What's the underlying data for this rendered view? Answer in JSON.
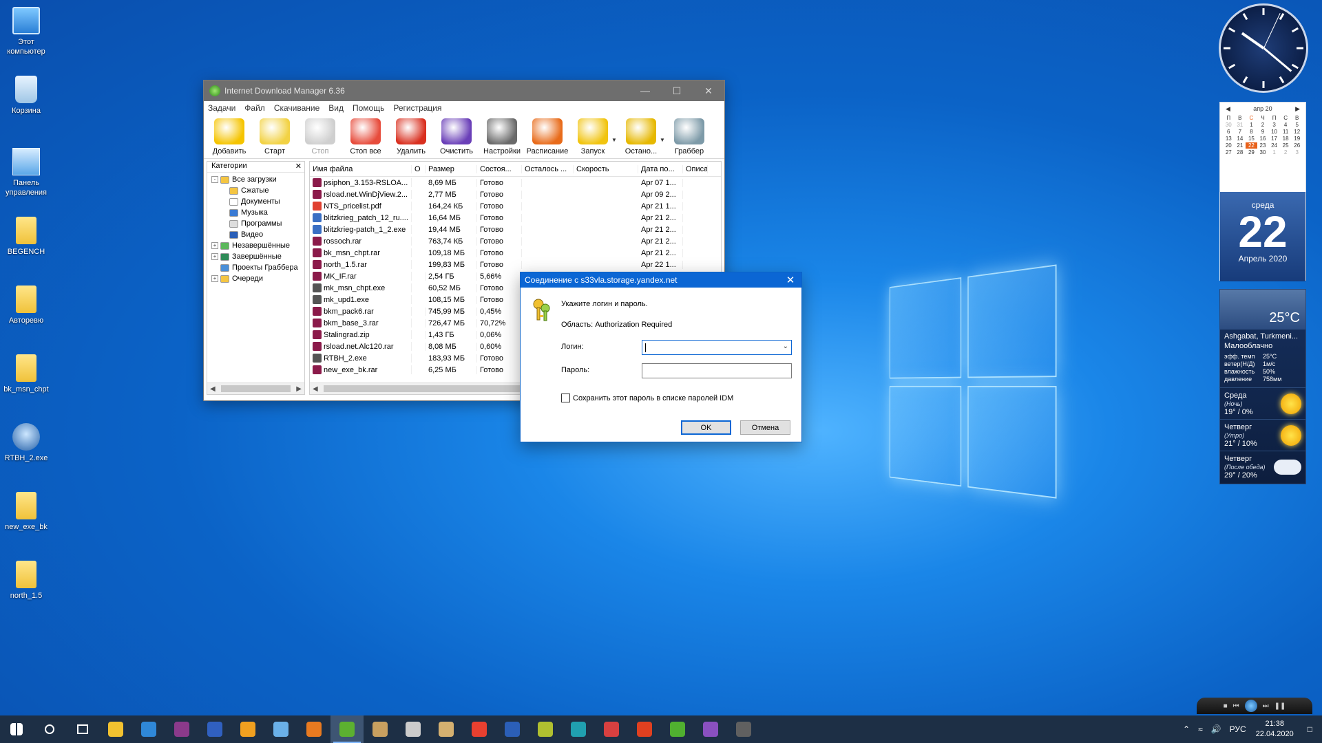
{
  "desktop_icons": [
    {
      "label": "Этот компьютер",
      "icon": "computer-icon"
    },
    {
      "label": "Корзина",
      "icon": "recycle-bin-icon"
    },
    {
      "label": "Панель управления",
      "icon": "control-panel-icon"
    },
    {
      "label": "BEGENCH",
      "icon": "folder-icon"
    },
    {
      "label": "Авторевю",
      "icon": "folder-icon"
    },
    {
      "label": "bk_msn_chpt",
      "icon": "folder-icon"
    },
    {
      "label": "RTBH_2.exe",
      "icon": "exe-icon"
    },
    {
      "label": "new_exe_bk",
      "icon": "folder-icon"
    },
    {
      "label": "north_1.5",
      "icon": "folder-icon"
    }
  ],
  "idm": {
    "title": "Internet Download Manager 6.36",
    "menu": [
      "Задачи",
      "Файл",
      "Скачивание",
      "Вид",
      "Помощь",
      "Регистрация"
    ],
    "toolbar": [
      {
        "label": "Добавить",
        "color": "#f5c400",
        "enabled": true
      },
      {
        "label": "Старт",
        "color": "#f2d244",
        "enabled": true
      },
      {
        "label": "Стоп",
        "color": "#cfcfcf",
        "enabled": false
      },
      {
        "label": "Стоп все",
        "color": "#e74c3c",
        "enabled": true
      },
      {
        "label": "Удалить",
        "color": "#d92f1f",
        "enabled": true
      },
      {
        "label": "Очистить",
        "color": "#6a3fb8",
        "enabled": true
      },
      {
        "label": "Настройки",
        "color": "#6a6a6a",
        "enabled": true
      },
      {
        "label": "Расписание",
        "color": "#e86b1a",
        "enabled": true
      },
      {
        "label": "Запуск",
        "color": "#f1c40f",
        "enabled": true
      },
      {
        "label": "Остано...",
        "color": "#e6b800",
        "enabled": true
      },
      {
        "label": "Граббер",
        "color": "#7d9aa8",
        "enabled": true
      }
    ],
    "categories": {
      "header": "Категории",
      "items": [
        {
          "label": "Все загрузки",
          "level": 0,
          "expander": "-",
          "color": "#f4c542"
        },
        {
          "label": "Сжатые",
          "level": 1,
          "expander": "",
          "color": "#f4c542"
        },
        {
          "label": "Документы",
          "level": 1,
          "expander": "",
          "color": "#ffffff"
        },
        {
          "label": "Музыка",
          "level": 1,
          "expander": "",
          "color": "#3a7bd5"
        },
        {
          "label": "Программы",
          "level": 1,
          "expander": "",
          "color": "#dddddd"
        },
        {
          "label": "Видео",
          "level": 1,
          "expander": "",
          "color": "#2a5fb8"
        },
        {
          "label": "Незавершённые",
          "level": 0,
          "expander": "+",
          "color": "#5cb85c"
        },
        {
          "label": "Завершённые",
          "level": 0,
          "expander": "+",
          "color": "#2e8b57"
        },
        {
          "label": "Проекты Граббера",
          "level": 0,
          "expander": "",
          "color": "#4a8fd8"
        },
        {
          "label": "Очереди",
          "level": 0,
          "expander": "+",
          "color": "#f4c542"
        }
      ]
    },
    "columns": [
      "Имя файла",
      "О",
      "Размер",
      "Состоя...",
      "Осталось ...",
      "Скорость",
      "Дата по...",
      "Описа"
    ],
    "files": [
      {
        "name": "psiphon_3.153-RSLOA...",
        "q": "",
        "size": "8,69 МБ",
        "status": "Готово",
        "left": "",
        "speed": "",
        "date": "Apr 07 1...",
        "icon": "#8b1a4a"
      },
      {
        "name": "rsload.net.WinDjView.2...",
        "q": "",
        "size": "2,77 МБ",
        "status": "Готово",
        "left": "",
        "speed": "",
        "date": "Apr 09 2...",
        "icon": "#8b1a4a"
      },
      {
        "name": "NTS_pricelist.pdf",
        "q": "",
        "size": "164,24 КБ",
        "status": "Готово",
        "left": "",
        "speed": "",
        "date": "Apr 21 1...",
        "icon": "#e04030"
      },
      {
        "name": "blitzkrieg_patch_12_ru....",
        "q": "",
        "size": "16,64 МБ",
        "status": "Готово",
        "left": "",
        "speed": "",
        "date": "Apr 21 2...",
        "icon": "#3a6fc4"
      },
      {
        "name": "blitzkrieg-patch_1_2.exe",
        "q": "",
        "size": "19,44 МБ",
        "status": "Готово",
        "left": "",
        "speed": "",
        "date": "Apr 21 2...",
        "icon": "#3a6fc4"
      },
      {
        "name": "rossoch.rar",
        "q": "",
        "size": "763,74 КБ",
        "status": "Готово",
        "left": "",
        "speed": "",
        "date": "Apr 21 2...",
        "icon": "#8b1a4a"
      },
      {
        "name": "bk_msn_chpt.rar",
        "q": "",
        "size": "109,18 МБ",
        "status": "Готово",
        "left": "",
        "speed": "",
        "date": "Apr 21 2...",
        "icon": "#8b1a4a"
      },
      {
        "name": "north_1.5.rar",
        "q": "",
        "size": "199,83 МБ",
        "status": "Готово",
        "left": "",
        "speed": "",
        "date": "Apr 22 1...",
        "icon": "#8b1a4a"
      },
      {
        "name": "MK_IF.rar",
        "q": "folder",
        "size": "2,54 ГБ",
        "status": "5,66%",
        "left": "",
        "speed": "",
        "date": "",
        "icon": "#8b1a4a"
      },
      {
        "name": "mk_msn_chpt.exe",
        "q": "",
        "size": "60,52 МБ",
        "status": "Готово",
        "left": "",
        "speed": "",
        "date": "",
        "icon": "#555555"
      },
      {
        "name": "mk_upd1.exe",
        "q": "",
        "size": "108,15 МБ",
        "status": "Готово",
        "left": "",
        "speed": "",
        "date": "",
        "icon": "#555555"
      },
      {
        "name": "bkm_pack6.rar",
        "q": "folder",
        "size": "745,99 МБ",
        "status": "0,45%",
        "left": "",
        "speed": "",
        "date": "",
        "icon": "#8b1a4a"
      },
      {
        "name": "bkm_base_3.rar",
        "q": "folder",
        "size": "726,47 МБ",
        "status": "70,72%",
        "left": "",
        "speed": "",
        "date": "",
        "icon": "#8b1a4a"
      },
      {
        "name": "Stalingrad.zip",
        "q": "folder",
        "size": "1,43 ГБ",
        "status": "0,06%",
        "left": "",
        "speed": "",
        "date": "",
        "icon": "#8b1a4a"
      },
      {
        "name": "rsload.net.Alc120.rar",
        "q": "folder",
        "size": "8,08 МБ",
        "status": "0,60%",
        "left": "",
        "speed": "",
        "date": "",
        "icon": "#8b1a4a"
      },
      {
        "name": "RTBH_2.exe",
        "q": "",
        "size": "183,93 МБ",
        "status": "Готово",
        "left": "",
        "speed": "",
        "date": "",
        "icon": "#555555"
      },
      {
        "name": "new_exe_bk.rar",
        "q": "",
        "size": "6,25 МБ",
        "status": "Готово",
        "left": "",
        "speed": "",
        "date": "",
        "icon": "#8b1a4a"
      }
    ]
  },
  "dialog": {
    "title": "Соединение с s33vla.storage.yandex.net",
    "prompt": "Укажите логин и пароль.",
    "realm": "Область: Authorization Required",
    "login_label": "Логин:",
    "login_value": "",
    "password_label": "Пароль:",
    "password_value": "",
    "save_checkbox_label": "Сохранить этот пароль в списке паролей IDM",
    "save_checked": false,
    "ok_label": "OK",
    "cancel_label": "Отмена"
  },
  "gadgets": {
    "calendar": {
      "month_label": "апр 20",
      "weekdays": [
        "П",
        "В",
        "С",
        "Ч",
        "П",
        "С",
        "В"
      ],
      "weeks": [
        [
          "30",
          "31",
          "1",
          "2",
          "3",
          "4",
          "5"
        ],
        [
          "6",
          "7",
          "8",
          "9",
          "10",
          "11",
          "12"
        ],
        [
          "13",
          "14",
          "15",
          "16",
          "17",
          "18",
          "19"
        ],
        [
          "20",
          "21",
          "22",
          "23",
          "24",
          "25",
          "26"
        ],
        [
          "27",
          "28",
          "29",
          "30",
          "1",
          "2",
          "3"
        ]
      ],
      "today": "22",
      "weekday_name": "среда",
      "day_number": "22",
      "month_year": "Апрель 2020"
    },
    "weather": {
      "temperature": "25°C",
      "location": "Ashgabat, Turkmeni...",
      "condition": "Малооблачно",
      "details": [
        {
          "label": "эфф. темп",
          "value": "25°C"
        },
        {
          "label": "ветер(Н/Д)",
          "value": "1м/с"
        },
        {
          "label": "влажность",
          "value": "50%"
        },
        {
          "label": "давление",
          "value": "758мм"
        }
      ],
      "forecast": [
        {
          "day": "Среда",
          "part": "(Ночь)",
          "temps": "19° /  0%",
          "icon": "sun-icon"
        },
        {
          "day": "Четверг",
          "part": "(Утро)",
          "temps": "21° /  10%",
          "icon": "sun-icon"
        },
        {
          "day": "Четверг",
          "part": "(После обеда)",
          "temps": "29° /  20%",
          "icon": "cloud-icon"
        }
      ]
    }
  },
  "taskbar": {
    "apps": [
      {
        "name": "start-button",
        "color": "#ffffff"
      },
      {
        "name": "search-icon",
        "color": "#ffffff"
      },
      {
        "name": "task-view-icon",
        "color": "#ffffff"
      },
      {
        "name": "file-explorer-icon",
        "color": "#f2c230"
      },
      {
        "name": "edge-icon",
        "color": "#2f88d8"
      },
      {
        "name": "winrar-icon",
        "color": "#8b3a8b"
      },
      {
        "name": "save-icon",
        "color": "#3060c0"
      },
      {
        "name": "aimp-icon",
        "color": "#f0a020"
      },
      {
        "name": "globe-icon",
        "color": "#6ab0e8"
      },
      {
        "name": "box-icon",
        "color": "#e87a20"
      },
      {
        "name": "idm-icon",
        "color": "#5cb030"
      },
      {
        "name": "pen-icon",
        "color": "#c8a060"
      },
      {
        "name": "calendar-app-icon",
        "color": "#cccccc"
      },
      {
        "name": "archive-icon",
        "color": "#d4b070"
      },
      {
        "name": "chrome-icon",
        "color": "#e84030"
      },
      {
        "name": "word-icon",
        "color": "#2b5fb8"
      },
      {
        "name": "game-icon",
        "color": "#b0c030"
      },
      {
        "name": "e-icon",
        "color": "#20a0b0"
      },
      {
        "name": "net-icon",
        "color": "#d84040"
      },
      {
        "name": "p-icon",
        "color": "#e04020"
      },
      {
        "name": "torrent-icon",
        "color": "#50b030"
      },
      {
        "name": "editor-icon",
        "color": "#8a50c0"
      },
      {
        "name": "tool-icon",
        "color": "#606060"
      }
    ],
    "active_index": 10,
    "tray_icons": [
      "^",
      "wifi",
      "volume"
    ],
    "language": "РУС",
    "time": "21:38",
    "date": "22.04.2020"
  }
}
